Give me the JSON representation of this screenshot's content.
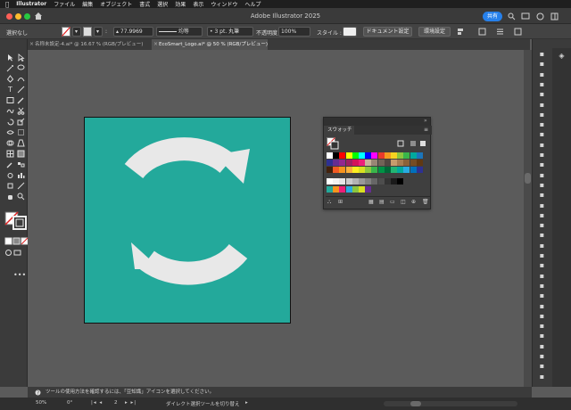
{
  "menubar": {
    "app_name": "Illustrator",
    "items": [
      "ファイル",
      "編集",
      "オブジェクト",
      "書式",
      "選択",
      "効果",
      "表示",
      "ウィンドウ",
      "ヘルプ"
    ]
  },
  "window": {
    "title": "Adobe Illustrator 2025",
    "share_label": "共有"
  },
  "controlbar": {
    "selection_label": "選択なし",
    "stroke_value": "77.9969",
    "profile_label": "均等",
    "brush_label": "3 pt. 丸筆",
    "opacity_label": "不透明度 :",
    "opacity_value": "100%",
    "style_label": "スタイル :",
    "document_settings": "ドキュメント設定",
    "preferences": "環境設定"
  },
  "tabs": [
    {
      "label": "名称未設定-4.ai* @ 16.67 % (RGB/プレビュー)",
      "active": false
    },
    {
      "label": "EcoSmart_Logo.ai* @ 50 % (RGB/プレビュー)",
      "active": true
    }
  ],
  "swatches_panel": {
    "title": "スウォッチ"
  },
  "hint": "ツールの使用方法を確認するには、「豆知識」アイコンを選択してください。",
  "status": {
    "zoom": "50%",
    "rotation": "0°",
    "artboard_number": "2",
    "tool_info": "ダイレクト選択ツールを切り替え"
  },
  "colors": {
    "artboard": "#23a99b",
    "arrows": "#e8e8e8",
    "accent": "#2680eb"
  }
}
